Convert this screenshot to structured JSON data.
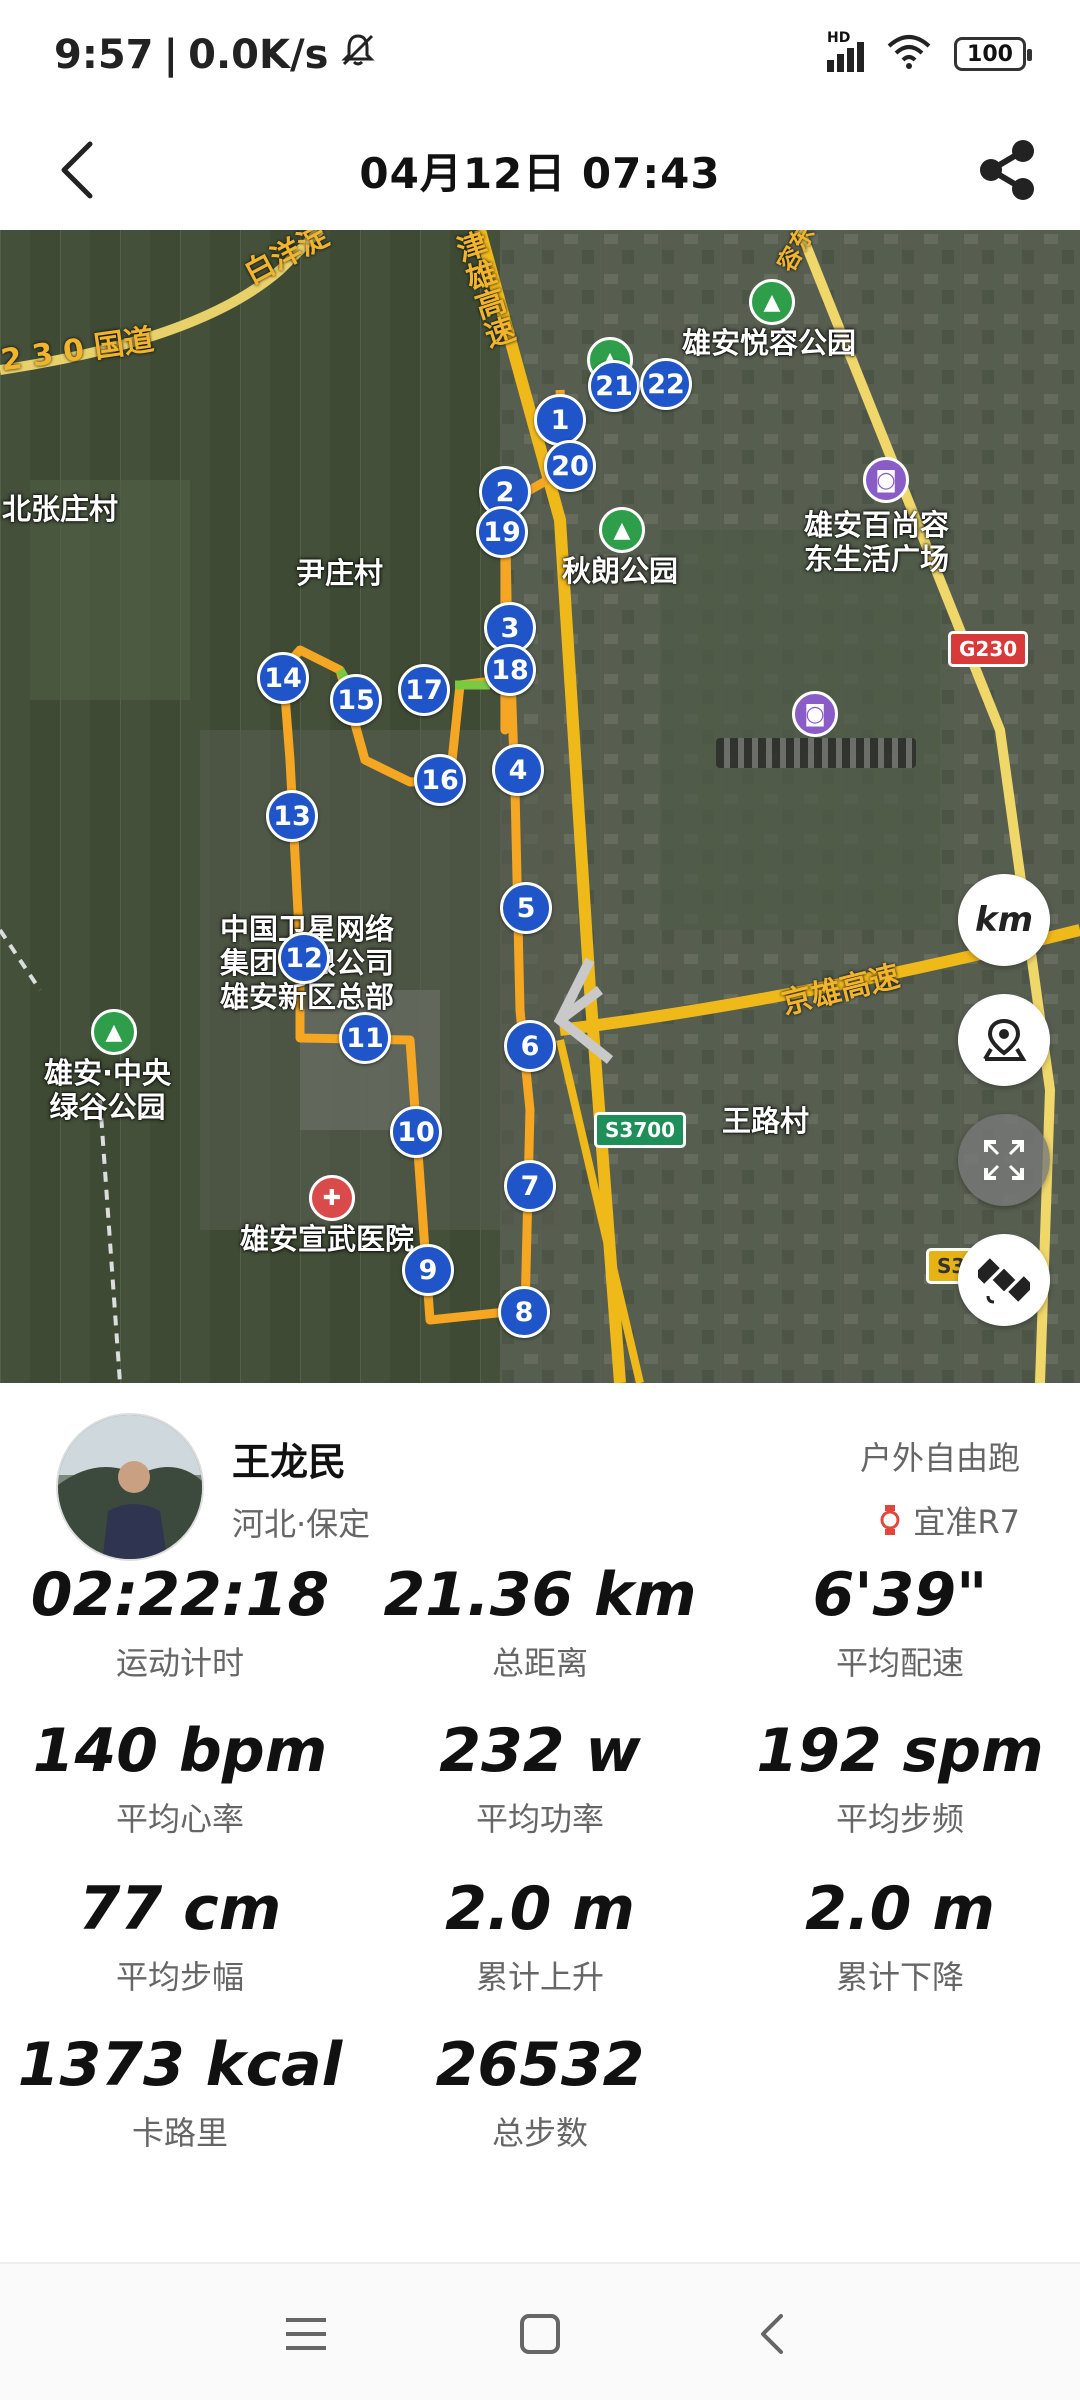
{
  "status_bar": {
    "time": "9:57",
    "speed": "0.0K/s",
    "signal_label": "HD",
    "battery": "100"
  },
  "header": {
    "title": "04月12日 07:43"
  },
  "map": {
    "labels": {
      "road_230": "2 3 0 国道",
      "road_baiyang": "白洋淀",
      "road_jinxiong": "津雄高速",
      "road_jingxiong": "京雄高速",
      "road_s3700": "S3700",
      "road_g230": "G230",
      "road_s3_partial": "S3",
      "beizhangzhuang": "北张庄村",
      "yinzhuang": "尹庄村",
      "qiulang_park": "秋朗公园",
      "yuerong_park": "雄安悦容公园",
      "baishangrong": "雄安百尚容\n东生活广场",
      "satellite_hq": "中国卫星网络\n集团有限公司\n雄安新区总部",
      "central_park": "雄安·中央\n绿谷公园",
      "xuanwu_hospital": "雄安宣武医院",
      "wanglu": "王路村",
      "rongdong_partial": "容东"
    },
    "km_markers": [
      "1",
      "2",
      "3",
      "4",
      "5",
      "6",
      "7",
      "8",
      "9",
      "10",
      "11",
      "12",
      "13",
      "14",
      "15",
      "16",
      "17",
      "18",
      "19",
      "20",
      "21",
      "22"
    ],
    "unit_button": "km",
    "colors": {
      "route": "#f5a623",
      "marker": "#1f55c8",
      "highway": "#f0c419",
      "park_poi": "#2e9e4a",
      "shop_poi": "#8a5cc7",
      "hospital_poi": "#d94a4a"
    }
  },
  "profile": {
    "name": "王龙民",
    "location": "河北·保定",
    "sport_type": "户外自由跑",
    "device": "宜准R7"
  },
  "stats": [
    {
      "value": "02:22:18",
      "label": "运动计时"
    },
    {
      "value": "21.36 km",
      "label": "总距离"
    },
    {
      "value": "6'39\"",
      "label": "平均配速"
    },
    {
      "value": "140 bpm",
      "label": "平均心率"
    },
    {
      "value": "232 w",
      "label": "平均功率"
    },
    {
      "value": "192 spm",
      "label": "平均步频"
    },
    {
      "value": "77 cm",
      "label": "平均步幅"
    },
    {
      "value": "2.0 m",
      "label": "累计上升"
    },
    {
      "value": "2.0 m",
      "label": "累计下降"
    },
    {
      "value": "1373 kcal",
      "label": "卡路里"
    },
    {
      "value": "26532",
      "label": "总步数"
    }
  ]
}
